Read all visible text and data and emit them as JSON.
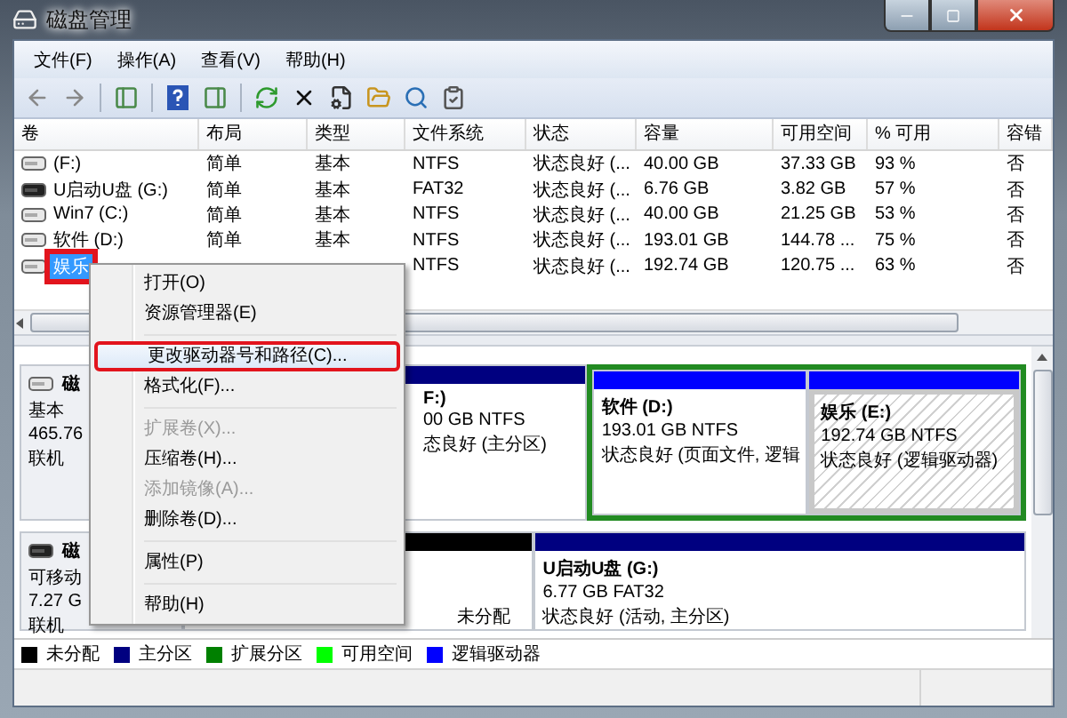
{
  "window": {
    "title": "磁盘管理"
  },
  "menu": [
    "文件(F)",
    "操作(A)",
    "查看(V)",
    "帮助(H)"
  ],
  "table": {
    "columns": [
      "卷",
      "布局",
      "类型",
      "文件系统",
      "状态",
      "容量",
      "可用空间",
      "% 可用",
      "容错"
    ],
    "rows": [
      {
        "cells": [
          "(F:)",
          "简单",
          "基本",
          "NTFS",
          "状态良好 (...",
          "40.00 GB",
          "37.33 GB",
          "93 %",
          "否"
        ],
        "removable": false,
        "selected": false,
        "annotated": false
      },
      {
        "cells": [
          "U启动U盘 (G:)",
          "简单",
          "基本",
          "FAT32",
          "状态良好 (...",
          "6.76 GB",
          "3.82 GB",
          "57 %",
          "否"
        ],
        "removable": true,
        "selected": false,
        "annotated": false
      },
      {
        "cells": [
          "Win7 (C:)",
          "简单",
          "基本",
          "NTFS",
          "状态良好 (...",
          "40.00 GB",
          "21.25 GB",
          "53 %",
          "否"
        ],
        "removable": false,
        "selected": false,
        "annotated": false
      },
      {
        "cells": [
          "软件 (D:)",
          "简单",
          "基本",
          "NTFS",
          "状态良好 (...",
          "193.01 GB",
          "144.78 ...",
          "75 %",
          "否"
        ],
        "removable": false,
        "selected": false,
        "annotated": false
      },
      {
        "cells": [
          "娱乐",
          null,
          null,
          "NTFS",
          "状态良好 (...",
          "192.74 GB",
          "120.75 ...",
          "63 %",
          "否"
        ],
        "removable": false,
        "selected": true,
        "annotated": true
      }
    ]
  },
  "disks": [
    {
      "lines": [
        "磁",
        "基本",
        "465.76",
        "联机"
      ],
      "removable": false,
      "partitions": [
        {
          "kind": "primary",
          "title": "F:)",
          "lines": [
            "00 GB NTFS",
            "态良好 (主分区)"
          ],
          "selected": false
        },
        {
          "kind": "extended",
          "children": [
            {
              "kind": "logical",
              "title": "软件  (D:)",
              "lines": [
                "193.01 GB NTFS",
                "状态良好 (页面文件, 逻辑"
              ],
              "selected": false
            },
            {
              "kind": "logical",
              "title": "娱乐  (E:)",
              "lines": [
                "192.74 GB NTFS",
                "状态良好 (逻辑驱动器)"
              ],
              "selected": true
            }
          ]
        }
      ]
    },
    {
      "lines": [
        "磁",
        "可移动",
        "7.27 G",
        "联机"
      ],
      "removable": true,
      "partitions": [
        {
          "kind": "unallocated",
          "lines": [
            "未分配"
          ],
          "selected": false
        },
        {
          "kind": "primary",
          "title": "U启动U盘  (G:)",
          "lines": [
            "6.77 GB FAT32",
            "状态良好 (活动, 主分区)"
          ],
          "selected": false
        }
      ]
    }
  ],
  "context_menu": [
    {
      "kind": "item",
      "label": "打开(O)",
      "disabled": false,
      "selected": false,
      "annotated": false
    },
    {
      "kind": "item",
      "label": "资源管理器(E)",
      "disabled": false,
      "selected": false,
      "annotated": false
    },
    {
      "kind": "separator"
    },
    {
      "kind": "item",
      "label": "更改驱动器号和路径(C)...",
      "disabled": false,
      "selected": true,
      "annotated": true
    },
    {
      "kind": "item",
      "label": "格式化(F)...",
      "disabled": false,
      "selected": false,
      "annotated": false
    },
    {
      "kind": "separator"
    },
    {
      "kind": "item",
      "label": "扩展卷(X)...",
      "disabled": true,
      "selected": false,
      "annotated": false
    },
    {
      "kind": "item",
      "label": "压缩卷(H)...",
      "disabled": false,
      "selected": false,
      "annotated": false
    },
    {
      "kind": "item",
      "label": "添加镜像(A)...",
      "disabled": true,
      "selected": false,
      "annotated": false
    },
    {
      "kind": "item",
      "label": "删除卷(D)...",
      "disabled": false,
      "selected": false,
      "annotated": false
    },
    {
      "kind": "separator"
    },
    {
      "kind": "item",
      "label": "属性(P)",
      "disabled": false,
      "selected": false,
      "annotated": false
    },
    {
      "kind": "separator"
    },
    {
      "kind": "item",
      "label": "帮助(H)",
      "disabled": false,
      "selected": false,
      "annotated": false
    }
  ],
  "legend": [
    {
      "label": "未分配",
      "color": "#000000"
    },
    {
      "label": "主分区",
      "color": "#000080"
    },
    {
      "label": "扩展分区",
      "color": "#008000"
    },
    {
      "label": "可用空间",
      "color": "#00ff00"
    },
    {
      "label": "逻辑驱动器",
      "color": "#0000ff"
    }
  ]
}
